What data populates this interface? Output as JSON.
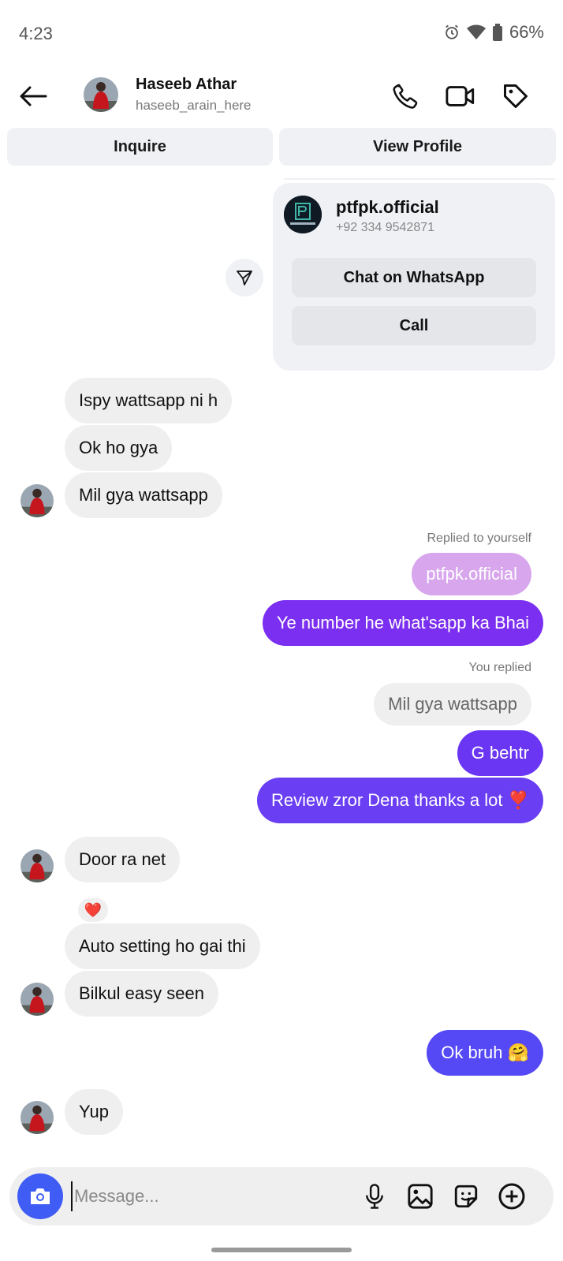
{
  "status_bar": {
    "time": "4:23",
    "battery": "66%"
  },
  "header": {
    "name": "Haseeb Athar",
    "username": "haseeb_arain_here"
  },
  "actions": {
    "inquire": "Inquire",
    "view_profile": "View Profile"
  },
  "shared_card": {
    "name": "ptfpk.official",
    "phone": "+92 334 9542871",
    "whatsapp_label": "Chat on WhatsApp",
    "call_label": "Call"
  },
  "messages": {
    "m1": "Ispy wattsapp ni h",
    "m2": "Ok ho gya",
    "m3": "Mil gya wattsapp",
    "reply1_label": "Replied to yourself",
    "reply1_quote": "ptfpk.official",
    "m4": "Ye number he what'sapp ka Bhai",
    "reply2_label": "You replied",
    "reply2_quote": "Mil gya wattsapp",
    "m5": "G behtr",
    "m6": "Review zror Dena thanks a lot ❣️",
    "m7": "Door ra net",
    "m7_reaction": "❤️",
    "m8": "Auto setting ho gai thi",
    "m9": "Bilkul easy seen",
    "m10": "Ok bruh 🤗",
    "m11": "Yup"
  },
  "composer": {
    "placeholder": "Message..."
  },
  "colors": {
    "accent": "#3f5cf5",
    "out_purple": "#7b2ff0",
    "out_violet": "#6a3ff3",
    "out_blue": "#5548f5",
    "bubble_in": "#efefef"
  },
  "icons": [
    "arrow-left-icon",
    "phone-icon",
    "video-icon",
    "tag-icon",
    "share-icon",
    "camera-icon",
    "microphone-icon",
    "gallery-icon",
    "sticker-icon",
    "plus-icon"
  ]
}
